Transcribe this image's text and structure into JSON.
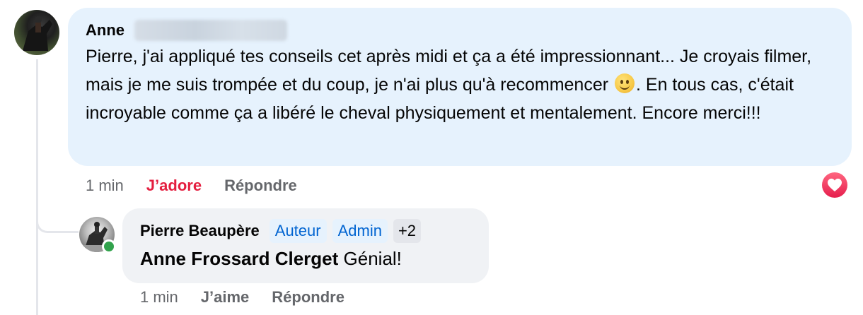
{
  "comment": {
    "author_first_name": "Anne",
    "text_part1": "Pierre, j'ai appliqué tes conseils cet après midi et ça a été impressionnant... Je croyais filmer, mais je me suis trompée et du coup, je n'ai plus qu'à recommencer",
    "emoji": "slightly-smiling-face",
    "text_part2": ". En tous cas, c'était incroyable comme ça a libéré le cheval physiquement et mentalement. Encore merci!!!",
    "time": "1 min",
    "reacted_label": "J’adore",
    "reply_label": "Répondre",
    "reaction_icon": "heart-icon",
    "accent_color": "#e41e3f"
  },
  "reply": {
    "author": "Pierre Beaupère",
    "badges": [
      "Auteur",
      "Admin"
    ],
    "more_badges": "+2",
    "mention": "Anne Frossard Clerget",
    "text": " Génial!",
    "time": "1 min",
    "like_label": "J’aime",
    "reply_label": "Répondre",
    "online": true
  }
}
